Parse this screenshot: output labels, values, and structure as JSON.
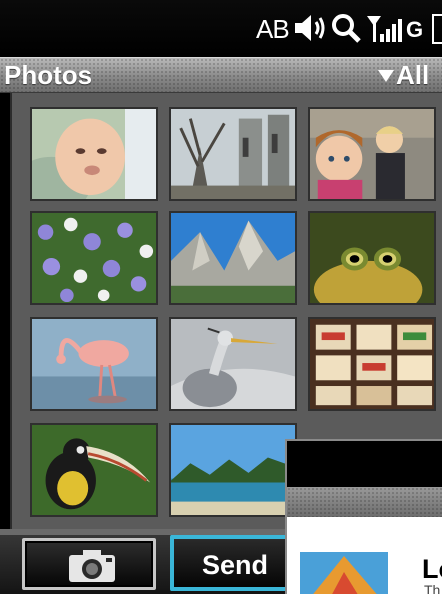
{
  "status": {
    "text": "AB",
    "network": "G",
    "icons": [
      "speaker-icon",
      "search-icon",
      "signal-icon",
      "battery-icon"
    ]
  },
  "title_bar": {
    "title": "Photos",
    "filter_label": "All",
    "filter_icon": "triangle-down-icon"
  },
  "photos": [
    {
      "name": "photo-baby",
      "subject": "baby"
    },
    {
      "name": "photo-cathedral",
      "subject": "cathedral"
    },
    {
      "name": "photo-children",
      "subject": "children"
    },
    {
      "name": "photo-flowers",
      "subject": "flowers"
    },
    {
      "name": "photo-mountains",
      "subject": "mountains"
    },
    {
      "name": "photo-frog",
      "subject": "frog"
    },
    {
      "name": "photo-flamingo",
      "subject": "flamingo"
    },
    {
      "name": "photo-heron",
      "subject": "heron"
    },
    {
      "name": "photo-market",
      "subject": "market"
    },
    {
      "name": "photo-toucan",
      "subject": "toucan"
    },
    {
      "name": "photo-lake",
      "subject": "lake"
    }
  ],
  "bottom_bar": {
    "camera_icon": "camera-icon",
    "send_label": "Send"
  },
  "overlay": {
    "title": "Lo",
    "subtitle": "Th"
  },
  "colors": {
    "send_accent": "#3ab6d8",
    "title_bar": "#8a8a8a",
    "grid_background": "#5b5b5b"
  }
}
